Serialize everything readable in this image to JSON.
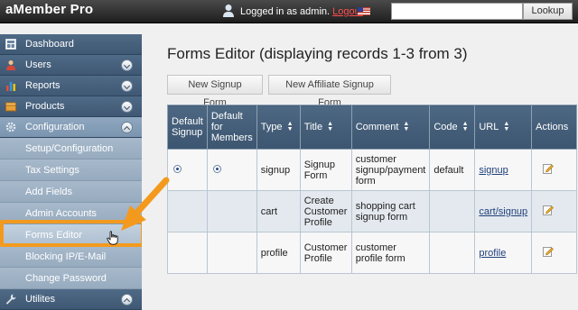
{
  "header": {
    "brand": "aMember Pro",
    "logged_in_text": "Logged in as admin.",
    "logout_label": "Logout",
    "search_placeholder": "",
    "lookup_label": "Lookup"
  },
  "sidebar": {
    "items": [
      {
        "label": "Dashboard",
        "icon": "dashboard-icon"
      },
      {
        "label": "Users",
        "icon": "users-icon"
      },
      {
        "label": "Reports",
        "icon": "reports-icon"
      },
      {
        "label": "Products",
        "icon": "products-icon"
      },
      {
        "label": "Configuration",
        "icon": "gear-icon"
      },
      {
        "label": "Utilites",
        "icon": "wrench-icon"
      }
    ],
    "sub_items": [
      {
        "label": "Setup/Configuration"
      },
      {
        "label": "Tax Settings"
      },
      {
        "label": "Add Fields"
      },
      {
        "label": "Admin Accounts"
      },
      {
        "label": "Forms Editor"
      },
      {
        "label": "Blocking IP/E-Mail"
      },
      {
        "label": "Change Password"
      }
    ]
  },
  "main": {
    "title": "Forms Editor (displaying records 1-3 from 3)",
    "buttons": {
      "new_signup": "New Signup Form",
      "new_affiliate": "New Affiliate Signup Form"
    },
    "table": {
      "headers": {
        "default_signup": "Default Signup",
        "default_members": "Default for Members",
        "type": "Type",
        "title": "Title",
        "comment": "Comment",
        "code": "Code",
        "url": "URL",
        "actions": "Actions"
      },
      "rows": [
        {
          "type": "signup",
          "title": "Signup Form",
          "comment": "customer signup/payment form",
          "code": "default",
          "url": "signup"
        },
        {
          "type": "cart",
          "title": "Create Customer Profile",
          "comment": "shopping cart signup form",
          "code": "",
          "url": "cart/signup"
        },
        {
          "type": "profile",
          "title": "Customer Profile",
          "comment": "customer profile form",
          "code": "",
          "url": "profile"
        }
      ]
    }
  },
  "colors": {
    "accent_orange": "#f39a1e",
    "nav_blue": "#3f5874",
    "logout_red": "#ff4d4d"
  }
}
